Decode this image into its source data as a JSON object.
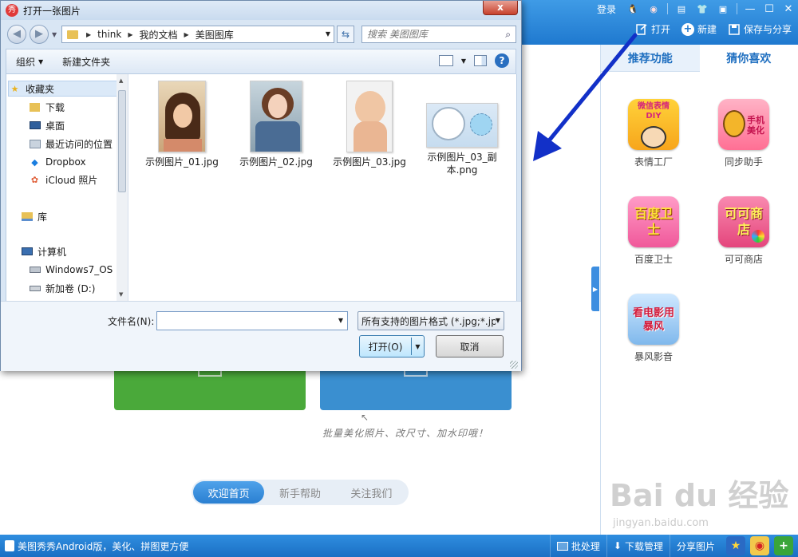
{
  "main_app": {
    "topbar": {
      "login_label": "登录",
      "toolbar": {
        "open_label": "打开",
        "new_label": "新建",
        "save_share_label": "保存与分享"
      }
    },
    "right_panel": {
      "tabs": [
        "推荐功能",
        "猜你喜欢"
      ],
      "apps": [
        {
          "label": "表情工厂",
          "icon_text": "微信表情DIY"
        },
        {
          "label": "同步助手",
          "icon_text": "手机美化"
        },
        {
          "label": "百度卫士",
          "icon_text": "百度卫士"
        },
        {
          "label": "可可商店",
          "icon_text": "可可商店"
        },
        {
          "label": "暴风影音",
          "icon_text": "看电影用暴风"
        }
      ]
    },
    "hint_text": "批量美化照片、改尺寸、加水印哦！",
    "home_tabs": [
      {
        "label": "欢迎首页",
        "active": true
      },
      {
        "label": "新手帮助",
        "active": false
      },
      {
        "label": "关注我们",
        "active": false
      }
    ],
    "statusbar": {
      "left_text": "美图秀秀Android版，美化、拼图更方便",
      "batch_label": "批处理",
      "download_label": "下载管理",
      "share_label": "分享图片"
    },
    "watermark": {
      "brand": "Bai du 经验",
      "url": "jingyan.baidu.com"
    }
  },
  "dialog": {
    "title": "打开一张图片",
    "close_label": "x",
    "breadcrumbs": [
      "think",
      "我的文档",
      "美图图库"
    ],
    "search_placeholder": "搜索 美图图库",
    "commands": {
      "organize_label": "组织",
      "new_folder_label": "新建文件夹"
    },
    "nav_items": [
      {
        "label": "收藏夹",
        "icon": "star-icon"
      },
      {
        "label": "下载",
        "icon": "download-folder-icon"
      },
      {
        "label": "桌面",
        "icon": "desktop-icon"
      },
      {
        "label": "最近访问的位置",
        "icon": "recent-places-icon"
      },
      {
        "label": "Dropbox",
        "icon": "dropbox-icon"
      },
      {
        "label": "iCloud 照片",
        "icon": "icloud-photos-icon"
      },
      {
        "label": "库",
        "icon": "library-icon"
      },
      {
        "label": "计算机",
        "icon": "computer-icon"
      },
      {
        "label": "Windows7_OS (",
        "icon": "drive-os-icon"
      },
      {
        "label": "新加卷 (D:)",
        "icon": "drive-icon"
      }
    ],
    "files": [
      {
        "name": "示例图片_01.jpg"
      },
      {
        "name": "示例图片_02.jpg"
      },
      {
        "name": "示例图片_03.jpg"
      },
      {
        "name_line1": "示例图片_03_副",
        "name_line2": "本.png"
      }
    ],
    "filename_label": "文件名(N):",
    "filename_value": "",
    "filter_label": "所有支持的图片格式 (*.jpg;*.jp",
    "open_label": "打开(O)",
    "cancel_label": "取消"
  },
  "colors": {
    "app_blue": "#1f79cf",
    "annotation_arrow": "#1230c8",
    "green_button": "#4aa93a",
    "blue_button": "#3a8fd0"
  }
}
